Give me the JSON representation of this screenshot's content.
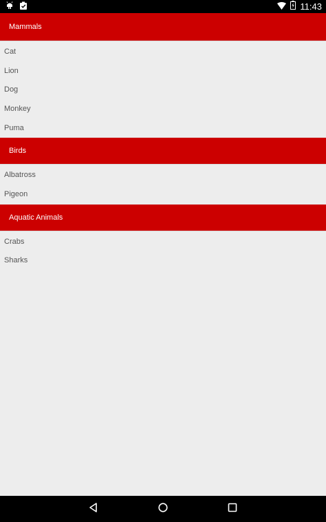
{
  "status_bar": {
    "time": "11:43",
    "icons": [
      "android-debug-icon",
      "clipboard-check-icon",
      "wifi-icon",
      "battery-charging-icon"
    ]
  },
  "groups": [
    {
      "title": "Mammals",
      "items": [
        "Cat",
        "Lion",
        "Dog",
        "Monkey",
        "Puma"
      ]
    },
    {
      "title": "Birds",
      "items": [
        "Albatross",
        "Pigeon"
      ]
    },
    {
      "title": "Aquatic Animals",
      "items": [
        "Crabs",
        "Sharks"
      ]
    }
  ],
  "nav_bar": {
    "icons": [
      "back-icon",
      "home-icon",
      "recents-icon"
    ]
  },
  "colors": {
    "header_bg": "#cc0000",
    "list_bg": "#ededed",
    "item_text": "#555555"
  }
}
